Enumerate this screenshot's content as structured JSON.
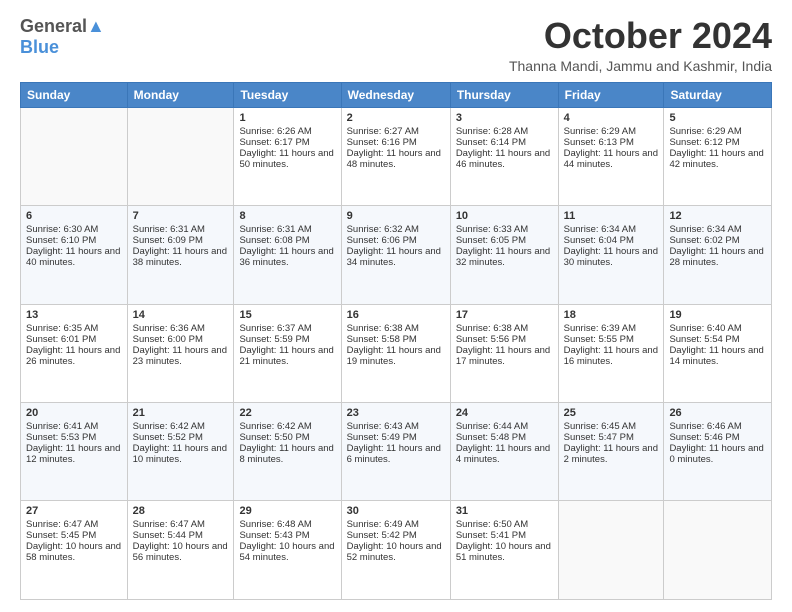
{
  "header": {
    "logo_general": "General",
    "logo_blue": "Blue",
    "month_title": "October 2024",
    "subtitle": "Thanna Mandi, Jammu and Kashmir, India"
  },
  "days_of_week": [
    "Sunday",
    "Monday",
    "Tuesday",
    "Wednesday",
    "Thursday",
    "Friday",
    "Saturday"
  ],
  "weeks": [
    [
      {
        "day": "",
        "sunrise": "",
        "sunset": "",
        "daylight": ""
      },
      {
        "day": "",
        "sunrise": "",
        "sunset": "",
        "daylight": ""
      },
      {
        "day": "1",
        "sunrise": "Sunrise: 6:26 AM",
        "sunset": "Sunset: 6:17 PM",
        "daylight": "Daylight: 11 hours and 50 minutes."
      },
      {
        "day": "2",
        "sunrise": "Sunrise: 6:27 AM",
        "sunset": "Sunset: 6:16 PM",
        "daylight": "Daylight: 11 hours and 48 minutes."
      },
      {
        "day": "3",
        "sunrise": "Sunrise: 6:28 AM",
        "sunset": "Sunset: 6:14 PM",
        "daylight": "Daylight: 11 hours and 46 minutes."
      },
      {
        "day": "4",
        "sunrise": "Sunrise: 6:29 AM",
        "sunset": "Sunset: 6:13 PM",
        "daylight": "Daylight: 11 hours and 44 minutes."
      },
      {
        "day": "5",
        "sunrise": "Sunrise: 6:29 AM",
        "sunset": "Sunset: 6:12 PM",
        "daylight": "Daylight: 11 hours and 42 minutes."
      }
    ],
    [
      {
        "day": "6",
        "sunrise": "Sunrise: 6:30 AM",
        "sunset": "Sunset: 6:10 PM",
        "daylight": "Daylight: 11 hours and 40 minutes."
      },
      {
        "day": "7",
        "sunrise": "Sunrise: 6:31 AM",
        "sunset": "Sunset: 6:09 PM",
        "daylight": "Daylight: 11 hours and 38 minutes."
      },
      {
        "day": "8",
        "sunrise": "Sunrise: 6:31 AM",
        "sunset": "Sunset: 6:08 PM",
        "daylight": "Daylight: 11 hours and 36 minutes."
      },
      {
        "day": "9",
        "sunrise": "Sunrise: 6:32 AM",
        "sunset": "Sunset: 6:06 PM",
        "daylight": "Daylight: 11 hours and 34 minutes."
      },
      {
        "day": "10",
        "sunrise": "Sunrise: 6:33 AM",
        "sunset": "Sunset: 6:05 PM",
        "daylight": "Daylight: 11 hours and 32 minutes."
      },
      {
        "day": "11",
        "sunrise": "Sunrise: 6:34 AM",
        "sunset": "Sunset: 6:04 PM",
        "daylight": "Daylight: 11 hours and 30 minutes."
      },
      {
        "day": "12",
        "sunrise": "Sunrise: 6:34 AM",
        "sunset": "Sunset: 6:02 PM",
        "daylight": "Daylight: 11 hours and 28 minutes."
      }
    ],
    [
      {
        "day": "13",
        "sunrise": "Sunrise: 6:35 AM",
        "sunset": "Sunset: 6:01 PM",
        "daylight": "Daylight: 11 hours and 26 minutes."
      },
      {
        "day": "14",
        "sunrise": "Sunrise: 6:36 AM",
        "sunset": "Sunset: 6:00 PM",
        "daylight": "Daylight: 11 hours and 23 minutes."
      },
      {
        "day": "15",
        "sunrise": "Sunrise: 6:37 AM",
        "sunset": "Sunset: 5:59 PM",
        "daylight": "Daylight: 11 hours and 21 minutes."
      },
      {
        "day": "16",
        "sunrise": "Sunrise: 6:38 AM",
        "sunset": "Sunset: 5:58 PM",
        "daylight": "Daylight: 11 hours and 19 minutes."
      },
      {
        "day": "17",
        "sunrise": "Sunrise: 6:38 AM",
        "sunset": "Sunset: 5:56 PM",
        "daylight": "Daylight: 11 hours and 17 minutes."
      },
      {
        "day": "18",
        "sunrise": "Sunrise: 6:39 AM",
        "sunset": "Sunset: 5:55 PM",
        "daylight": "Daylight: 11 hours and 16 minutes."
      },
      {
        "day": "19",
        "sunrise": "Sunrise: 6:40 AM",
        "sunset": "Sunset: 5:54 PM",
        "daylight": "Daylight: 11 hours and 14 minutes."
      }
    ],
    [
      {
        "day": "20",
        "sunrise": "Sunrise: 6:41 AM",
        "sunset": "Sunset: 5:53 PM",
        "daylight": "Daylight: 11 hours and 12 minutes."
      },
      {
        "day": "21",
        "sunrise": "Sunrise: 6:42 AM",
        "sunset": "Sunset: 5:52 PM",
        "daylight": "Daylight: 11 hours and 10 minutes."
      },
      {
        "day": "22",
        "sunrise": "Sunrise: 6:42 AM",
        "sunset": "Sunset: 5:50 PM",
        "daylight": "Daylight: 11 hours and 8 minutes."
      },
      {
        "day": "23",
        "sunrise": "Sunrise: 6:43 AM",
        "sunset": "Sunset: 5:49 PM",
        "daylight": "Daylight: 11 hours and 6 minutes."
      },
      {
        "day": "24",
        "sunrise": "Sunrise: 6:44 AM",
        "sunset": "Sunset: 5:48 PM",
        "daylight": "Daylight: 11 hours and 4 minutes."
      },
      {
        "day": "25",
        "sunrise": "Sunrise: 6:45 AM",
        "sunset": "Sunset: 5:47 PM",
        "daylight": "Daylight: 11 hours and 2 minutes."
      },
      {
        "day": "26",
        "sunrise": "Sunrise: 6:46 AM",
        "sunset": "Sunset: 5:46 PM",
        "daylight": "Daylight: 11 hours and 0 minutes."
      }
    ],
    [
      {
        "day": "27",
        "sunrise": "Sunrise: 6:47 AM",
        "sunset": "Sunset: 5:45 PM",
        "daylight": "Daylight: 10 hours and 58 minutes."
      },
      {
        "day": "28",
        "sunrise": "Sunrise: 6:47 AM",
        "sunset": "Sunset: 5:44 PM",
        "daylight": "Daylight: 10 hours and 56 minutes."
      },
      {
        "day": "29",
        "sunrise": "Sunrise: 6:48 AM",
        "sunset": "Sunset: 5:43 PM",
        "daylight": "Daylight: 10 hours and 54 minutes."
      },
      {
        "day": "30",
        "sunrise": "Sunrise: 6:49 AM",
        "sunset": "Sunset: 5:42 PM",
        "daylight": "Daylight: 10 hours and 52 minutes."
      },
      {
        "day": "31",
        "sunrise": "Sunrise: 6:50 AM",
        "sunset": "Sunset: 5:41 PM",
        "daylight": "Daylight: 10 hours and 51 minutes."
      },
      {
        "day": "",
        "sunrise": "",
        "sunset": "",
        "daylight": ""
      },
      {
        "day": "",
        "sunrise": "",
        "sunset": "",
        "daylight": ""
      }
    ]
  ]
}
